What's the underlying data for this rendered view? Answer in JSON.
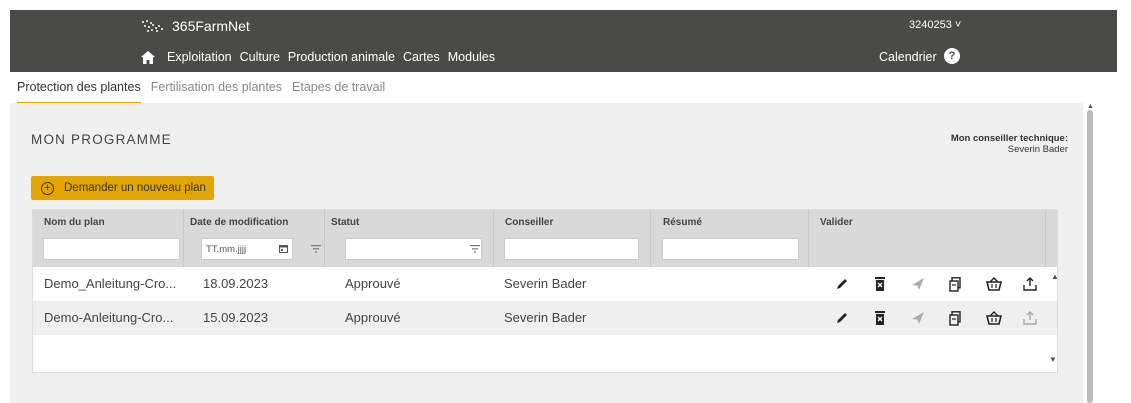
{
  "app": {
    "brand": "365FarmNet",
    "account": "3240253 ˅",
    "nav": [
      "Exploitation",
      "Culture",
      "Production animale",
      "Cartes",
      "Modules"
    ],
    "calendar": "Calendrier",
    "help": "?"
  },
  "subtabs": [
    "Protection des plantes",
    "Fertilisation des plantes",
    "Etapes de travail"
  ],
  "panel": {
    "title": "MON PROGRAMME",
    "advisor_label": "Mon conseiller technique:",
    "advisor_name": "Severin Bader",
    "new_plan_button": "Demander un nouveau plan"
  },
  "grid": {
    "columns": [
      "Nom du plan",
      "Date de modification",
      "Statut",
      "Conseiller",
      "Résumé",
      "Valider"
    ],
    "date_placeholder": "TT.mm.jjjj",
    "rows": [
      {
        "name": "Demo_Anleitung-Cro...",
        "date": "18.09.2023",
        "status": "Approuvé",
        "advisor": "Severin Bader"
      },
      {
        "name": "Demo-Anleitung-Cro...",
        "date": "15.09.2023",
        "status": "Approuvé",
        "advisor": "Severin Bader"
      }
    ]
  },
  "colors": {
    "topbar": "#4a4a48",
    "accent": "#e5a500",
    "panel_bg": "#f0f0f0"
  },
  "icons": [
    "home-icon",
    "help-icon",
    "plus-circle-icon",
    "calendar-icon",
    "filter-icon",
    "edit-icon",
    "delete-icon",
    "send-icon",
    "copy-icon",
    "basket-icon",
    "export-icon"
  ]
}
